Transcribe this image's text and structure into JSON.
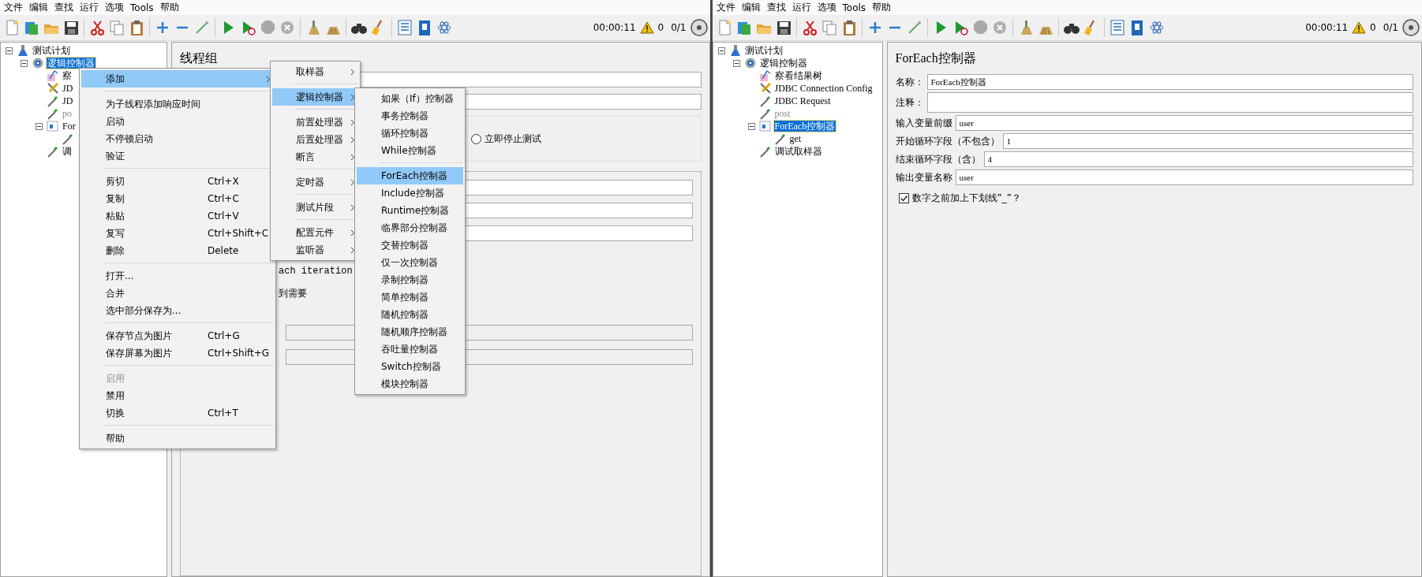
{
  "windows": [
    {
      "menu_bar": [
        "文件",
        "编辑",
        "查找",
        "运行",
        "选项",
        "Tools",
        "帮助"
      ],
      "toolbar": {
        "timer": "00:00:11",
        "warnings": "0",
        "threads": "0/1"
      },
      "tree": [
        {
          "label": "测试计划",
          "kind": "test_plan",
          "selected": false,
          "expanded": true,
          "children": [
            {
              "label": "逻辑控制器",
              "kind": "logic_controller",
              "selected": true,
              "expanded": true,
              "children": [
                {
                  "label": "察",
                  "kind": "listener",
                  "selected": false
                },
                {
                  "label": "JD",
                  "kind": "config",
                  "selected": false
                },
                {
                  "label": "JD",
                  "kind": "sampler",
                  "selected": false
                },
                {
                  "label": "po",
                  "kind": "sampler",
                  "selected": false,
                  "disabled": true
                },
                {
                  "label": "For",
                  "kind": "foreach_controller",
                  "selected": false,
                  "expanded": true,
                  "children": [
                    {
                      "kind": "sampler"
                    }
                  ]
                },
                {
                  "label": "调",
                  "kind": "sampler",
                  "selected": false
                }
              ]
            }
          ]
        }
      ],
      "panel": {
        "kind": "thread_group",
        "title": "线程组",
        "radio": {
          "label": "立即停止测试",
          "selected": false
        },
        "fragments": [
          "ach iteration",
          "到需要"
        ]
      },
      "context_menus": [
        {
          "items": [
            {
              "kind": "item",
              "label": "添加",
              "selected": true,
              "disabled": false,
              "submenu": true
            },
            {
              "kind": "separator"
            },
            {
              "kind": "item",
              "label": "为子线程添加响应时间",
              "selected": false,
              "disabled": false,
              "submenu": false
            },
            {
              "kind": "item",
              "label": "启动",
              "selected": false,
              "disabled": false,
              "submenu": false
            },
            {
              "kind": "item",
              "label": "不停顿启动",
              "selected": false,
              "disabled": false,
              "submenu": false
            },
            {
              "kind": "item",
              "label": "验证",
              "selected": false,
              "disabled": false,
              "submenu": false
            },
            {
              "kind": "separator"
            },
            {
              "kind": "item",
              "label": "剪切",
              "shortcut": "Ctrl+X",
              "selected": false,
              "disabled": false,
              "submenu": false
            },
            {
              "kind": "item",
              "label": "复制",
              "shortcut": "Ctrl+C",
              "selected": false,
              "disabled": false,
              "submenu": false
            },
            {
              "kind": "item",
              "label": "粘贴",
              "shortcut": "Ctrl+V",
              "selected": false,
              "disabled": false,
              "submenu": false
            },
            {
              "kind": "item",
              "label": "复写",
              "shortcut": "Ctrl+Shift+C",
              "selected": false,
              "disabled": false,
              "submenu": false
            },
            {
              "kind": "item",
              "label": "删除",
              "shortcut": "Delete",
              "selected": false,
              "disabled": false,
              "submenu": false
            },
            {
              "kind": "separator"
            },
            {
              "kind": "item",
              "label": "打开...",
              "selected": false,
              "disabled": false,
              "submenu": false
            },
            {
              "kind": "item",
              "label": "合并",
              "selected": false,
              "disabled": false,
              "submenu": false
            },
            {
              "kind": "item",
              "label": "选中部分保存为...",
              "selected": false,
              "disabled": false,
              "submenu": false
            },
            {
              "kind": "separator"
            },
            {
              "kind": "item",
              "label": "保存节点为图片",
              "shortcut": "Ctrl+G",
              "selected": false,
              "disabled": false,
              "submenu": false
            },
            {
              "kind": "item",
              "label": "保存屏幕为图片",
              "shortcut": "Ctrl+Shift+G",
              "selected": false,
              "disabled": false,
              "submenu": false
            },
            {
              "kind": "separator"
            },
            {
              "kind": "item",
              "label": "启用",
              "selected": false,
              "disabled": true,
              "submenu": false
            },
            {
              "kind": "item",
              "label": "禁用",
              "selected": false,
              "disabled": false,
              "submenu": false
            },
            {
              "kind": "item",
              "label": "切换",
              "shortcut": "Ctrl+T",
              "selected": false,
              "disabled": false,
              "submenu": false
            },
            {
              "kind": "separator"
            },
            {
              "kind": "item",
              "label": "帮助",
              "selected": false,
              "disabled": false,
              "submenu": false
            }
          ]
        },
        {
          "items": [
            {
              "kind": "item",
              "label": "取样器",
              "selected": false,
              "submenu": true
            },
            {
              "kind": "separator"
            },
            {
              "kind": "item",
              "label": "逻辑控制器",
              "selected": true,
              "submenu": true
            },
            {
              "kind": "separator"
            },
            {
              "kind": "item",
              "label": "前置处理器",
              "selected": false,
              "submenu": true
            },
            {
              "kind": "item",
              "label": "后置处理器",
              "selected": false,
              "submenu": true
            },
            {
              "kind": "item",
              "label": "断言",
              "selected": false,
              "submenu": true
            },
            {
              "kind": "separator"
            },
            {
              "kind": "item",
              "label": "定时器",
              "selected": false,
              "submenu": true
            },
            {
              "kind": "separator"
            },
            {
              "kind": "item",
              "label": "测试片段",
              "selected": false,
              "submenu": true
            },
            {
              "kind": "separator"
            },
            {
              "kind": "item",
              "label": "配置元件",
              "selected": false,
              "submenu": true
            },
            {
              "kind": "item",
              "label": "监听器",
              "selected": false,
              "submenu": true
            }
          ]
        },
        {
          "items": [
            {
              "kind": "item",
              "label": "如果（If）控制器",
              "selected": false
            },
            {
              "kind": "item",
              "label": "事务控制器",
              "selected": false
            },
            {
              "kind": "item",
              "label": "循环控制器",
              "selected": false
            },
            {
              "kind": "item",
              "label": "While控制器",
              "selected": false
            },
            {
              "kind": "separator"
            },
            {
              "kind": "item",
              "label": "ForEach控制器",
              "selected": true
            },
            {
              "kind": "item",
              "label": "Include控制器",
              "selected": false
            },
            {
              "kind": "item",
              "label": "Runtime控制器",
              "selected": false
            },
            {
              "kind": "item",
              "label": "临界部分控制器",
              "selected": false
            },
            {
              "kind": "item",
              "label": "交替控制器",
              "selected": false
            },
            {
              "kind": "item",
              "label": "仅一次控制器",
              "selected": false
            },
            {
              "kind": "item",
              "label": "录制控制器",
              "selected": false
            },
            {
              "kind": "item",
              "label": "简单控制器",
              "selected": false
            },
            {
              "kind": "item",
              "label": "随机控制器",
              "selected": false
            },
            {
              "kind": "item",
              "label": "随机顺序控制器",
              "selected": false
            },
            {
              "kind": "item",
              "label": "吞吐量控制器",
              "selected": false
            },
            {
              "kind": "item",
              "label": "Switch控制器",
              "selected": false
            },
            {
              "kind": "item",
              "label": "模块控制器",
              "selected": false
            }
          ]
        }
      ]
    },
    {
      "menu_bar": [
        "文件",
        "编辑",
        "查找",
        "运行",
        "选项",
        "Tools",
        "帮助"
      ],
      "toolbar": {
        "timer": "00:00:11",
        "warnings": "0",
        "threads": "0/1"
      },
      "tree": [
        {
          "label": "测试计划",
          "kind": "test_plan",
          "selected": false,
          "expanded": true,
          "children": [
            {
              "label": "逻辑控制器",
              "kind": "logic_controller",
              "selected": false,
              "expanded": true,
              "children": [
                {
                  "label": "察看结果树",
                  "kind": "listener",
                  "selected": false
                },
                {
                  "label": "JDBC Connection Config",
                  "kind": "config",
                  "selected": false
                },
                {
                  "label": "JDBC Request",
                  "kind": "sampler",
                  "selected": false
                },
                {
                  "label": "post",
                  "kind": "sampler",
                  "selected": false,
                  "disabled": true
                },
                {
                  "label": "ForEach控制器",
                  "kind": "foreach_controller",
                  "selected": true,
                  "expanded": true,
                  "children": [
                    {
                      "label": "get",
                      "kind": "sampler",
                      "selected": false
                    }
                  ]
                },
                {
                  "label": "调试取样器",
                  "kind": "sampler",
                  "selected": false
                }
              ]
            }
          ]
        }
      ],
      "panel": {
        "kind": "foreach",
        "title": "ForEach控制器",
        "fields": [
          {
            "kind": "text",
            "label": "名称：",
            "value": "ForEach控制器"
          },
          {
            "kind": "textarea",
            "label": "注释："
          },
          {
            "kind": "text",
            "label": "输入变量前缀",
            "value": "user"
          },
          {
            "kind": "text",
            "label": "开始循环字段（不包含）",
            "value": "1"
          },
          {
            "kind": "text",
            "label": "结束循环字段（含）",
            "value": "4"
          },
          {
            "kind": "text",
            "label": "输出变量名称",
            "value": "user"
          }
        ],
        "checkbox": {
          "label": "数字之前加上下划线”_”？",
          "checked": true
        }
      }
    }
  ]
}
